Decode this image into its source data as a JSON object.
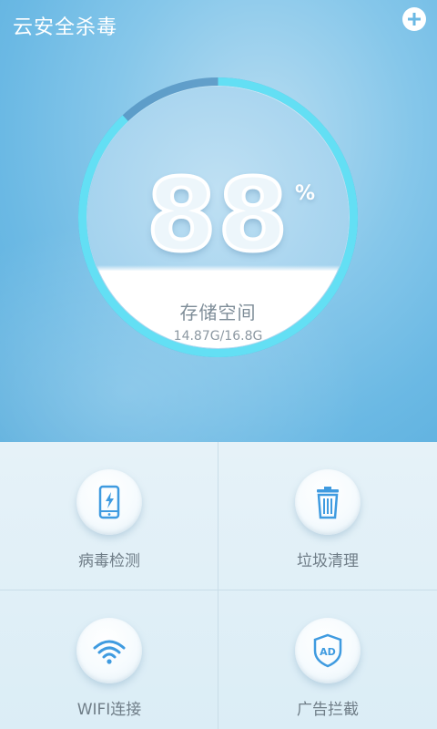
{
  "header": {
    "title": "云安全杀毒",
    "add_icon": "plus-icon"
  },
  "gauge": {
    "percent": "88",
    "percent_sign": "%",
    "label": "存储空间",
    "value": "14.87G/16.8G",
    "fill_fraction": 0.88
  },
  "features": [
    {
      "label": "病毒检测",
      "icon": "phone-charge-icon"
    },
    {
      "label": "垃圾清理",
      "icon": "trash-icon"
    },
    {
      "label": "WIFI连接",
      "icon": "wifi-icon"
    },
    {
      "label": "广告拦截",
      "icon": "ad-shield-icon"
    }
  ],
  "colors": {
    "accent": "#5fd6f0",
    "hero_bg": "#6bb9e4",
    "icon_blue": "#3f9be0"
  }
}
